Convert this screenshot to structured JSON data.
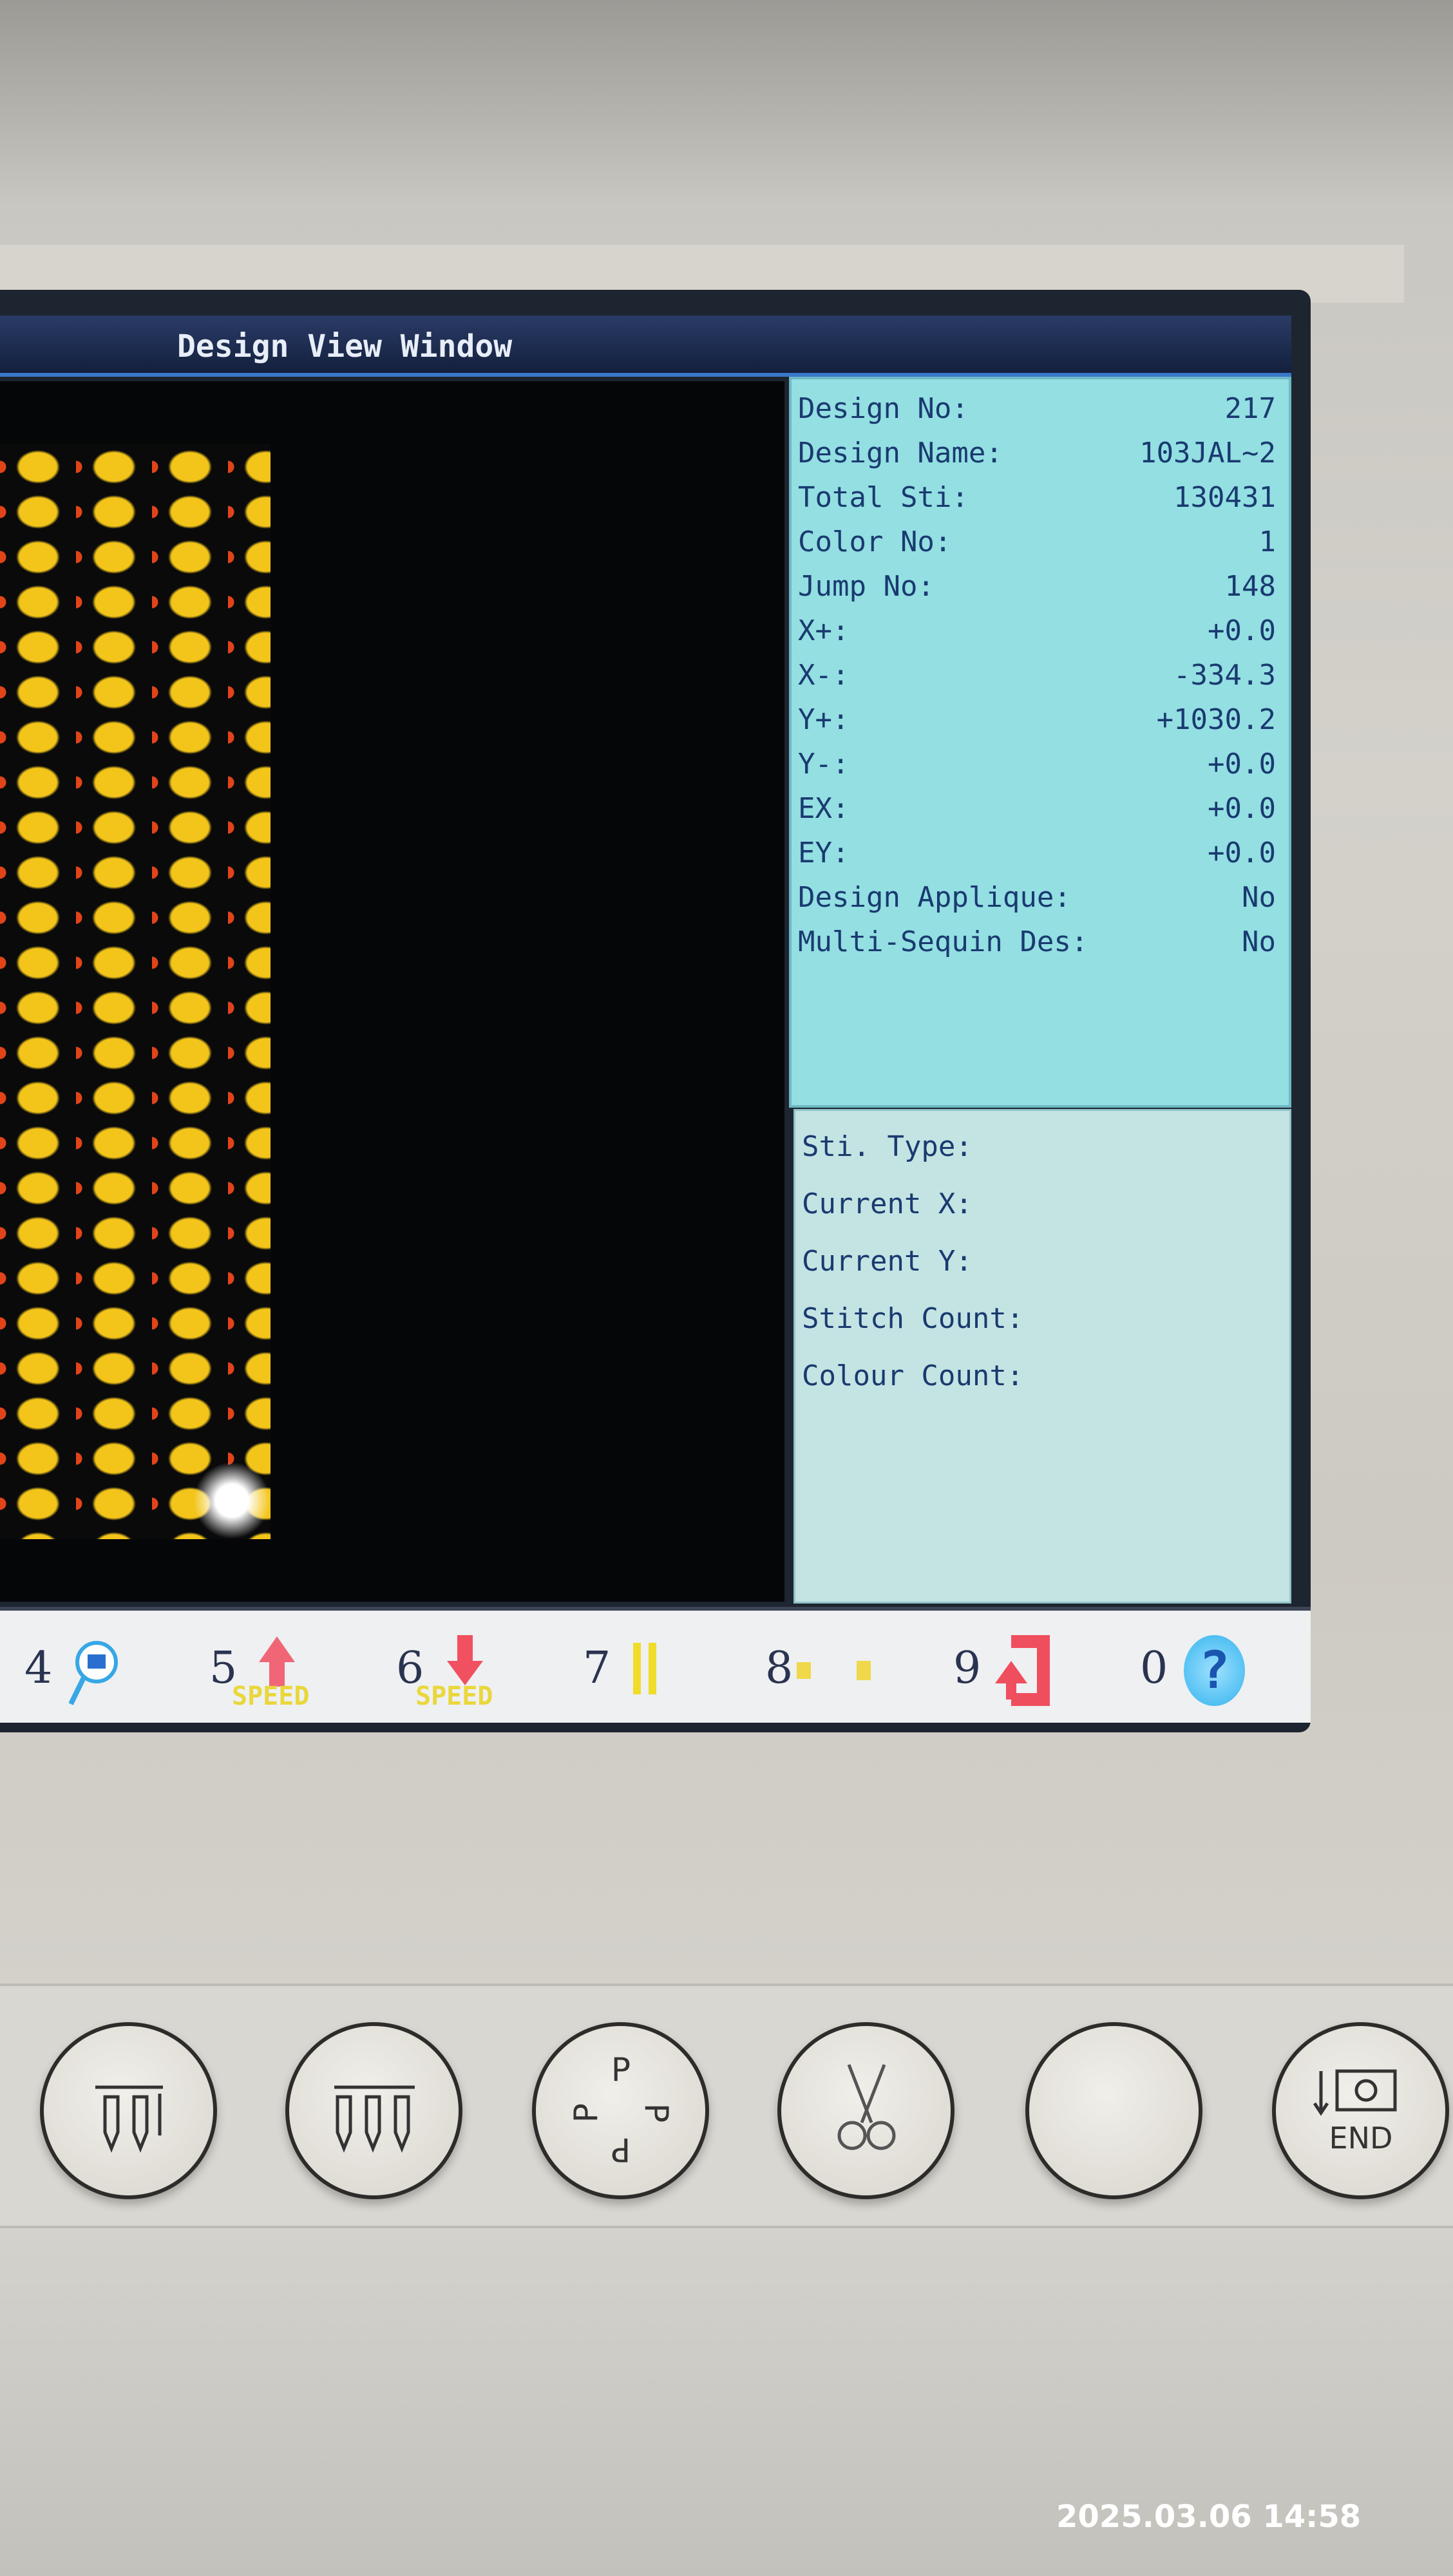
{
  "title": "Design View Window",
  "info": [
    {
      "label": "Design No:",
      "value": "217"
    },
    {
      "label": "Design Name:",
      "value": "103JAL~2"
    },
    {
      "label": "Total Sti:",
      "value": "130431"
    },
    {
      "label": "Color No:",
      "value": "1"
    },
    {
      "label": "Jump No:",
      "value": "148"
    },
    {
      "label": "X+:",
      "value": "+0.0"
    },
    {
      "label": "X-:",
      "value": "-334.3"
    },
    {
      "label": "Y+:",
      "value": "+1030.2"
    },
    {
      "label": "Y-:",
      "value": "+0.0"
    },
    {
      "label": "EX:",
      "value": "+0.0"
    },
    {
      "label": "EY:",
      "value": "+0.0"
    },
    {
      "label": "Design Applique:",
      "value": "No"
    },
    {
      "label": "Multi-Sequin Des:",
      "value": "No"
    }
  ],
  "status": [
    {
      "label": "Sti. Type:"
    },
    {
      "label": "Current X:"
    },
    {
      "label": "Current Y:"
    },
    {
      "label": "Stitch Count:"
    },
    {
      "label": "Colour Count:"
    }
  ],
  "function_keys": [
    {
      "key": "4",
      "icon": "zoom-view-icon"
    },
    {
      "key": "5",
      "icon": "speed-up-icon",
      "sub": "SPEED"
    },
    {
      "key": "6",
      "icon": "speed-down-icon",
      "sub": "SPEED"
    },
    {
      "key": "7",
      "icon": "pause-icon"
    },
    {
      "key": "8",
      "icon": "frame-move-icon"
    },
    {
      "key": "9",
      "icon": "return-icon"
    },
    {
      "key": "0",
      "icon": "help-icon",
      "glyph": "?"
    }
  ],
  "hardware_buttons": [
    {
      "icon": "single-needle-icon"
    },
    {
      "icon": "multi-needle-icon"
    },
    {
      "icon": "rotate-p-icon",
      "glyph": "P"
    },
    {
      "icon": "scissors-icon"
    },
    {
      "icon": "blank-button"
    },
    {
      "icon": "end-icon",
      "label": "END"
    }
  ],
  "timestamp": "2025.03.06 14:58",
  "colors": {
    "info_bg": "#93dfe2",
    "status_bg": "#c3e4e3",
    "text": "#1a3a70",
    "titlebar": "#13203d"
  }
}
